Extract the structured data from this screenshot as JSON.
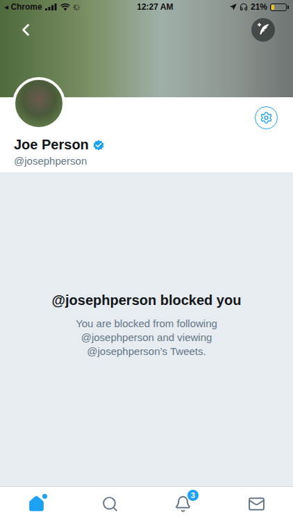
{
  "status_bar": {
    "back_mark": "◂",
    "back_app": "Chrome",
    "time": "12:27 AM",
    "battery": "21%",
    "battery_level": 0.21
  },
  "profile": {
    "name": "Joe Person",
    "verified": true,
    "handle": "@josephperson"
  },
  "blocked": {
    "title": "@josephperson blocked you",
    "lines": [
      "You are blocked from following",
      "@josephperson and viewing",
      "@josephperson’s Tweets."
    ]
  },
  "tab_bar": {
    "items": [
      {
        "kind": "home",
        "selected": true,
        "dot": true
      },
      {
        "kind": "search",
        "selected": false,
        "dot": false
      },
      {
        "kind": "notifications",
        "selected": false,
        "dot": false,
        "badge": "3"
      },
      {
        "kind": "messages",
        "selected": false,
        "dot": false
      }
    ]
  }
}
